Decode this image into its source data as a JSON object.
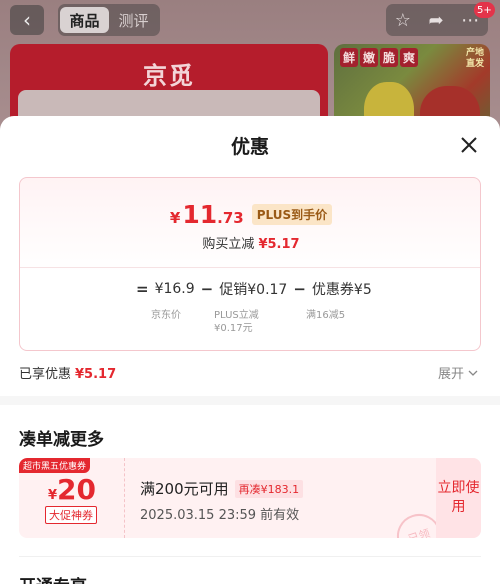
{
  "background": {
    "tabs": [
      "商品",
      "测评"
    ],
    "badge": "5+",
    "logo_text": "京觅",
    "tags": [
      "鲜",
      "嫩",
      "脆",
      "爽"
    ],
    "origin_line1": "产地",
    "origin_line2": "直发"
  },
  "sheet": {
    "title": "优惠",
    "final_price": {
      "yen": "¥",
      "integer": "11",
      "decimal": ".73"
    },
    "plus_tag": "PLUS到手价",
    "save_label": "购买立减",
    "save_amount": "¥5.17",
    "formula": {
      "equals": "=",
      "minus": "−",
      "price": "¥16.9",
      "promo": "促销¥0.17",
      "coupon": "优惠券¥5"
    },
    "sub_labels": {
      "price": "京东价",
      "promo_line1": "PLUS立减",
      "promo_line2": "¥0.17元",
      "coupon": "满16减5"
    },
    "enjoyed_label": "已享优惠",
    "enjoyed_amount": "¥5.17",
    "expand_label": "展开"
  },
  "more": {
    "title": "凑单减更多",
    "coupon": {
      "flag": "超市黑五优惠券",
      "yen": "¥",
      "value": "20",
      "type": "大促神券",
      "condition": "满200元可用",
      "extra": "再凑¥183.1",
      "valid": "2025.03.15 23:59 前有效",
      "button": "立即使用",
      "stamp": "已领"
    }
  },
  "next_section_title": "开通专享",
  "colors": {
    "accent": "#e4282f",
    "plus": "#9a5a16"
  }
}
